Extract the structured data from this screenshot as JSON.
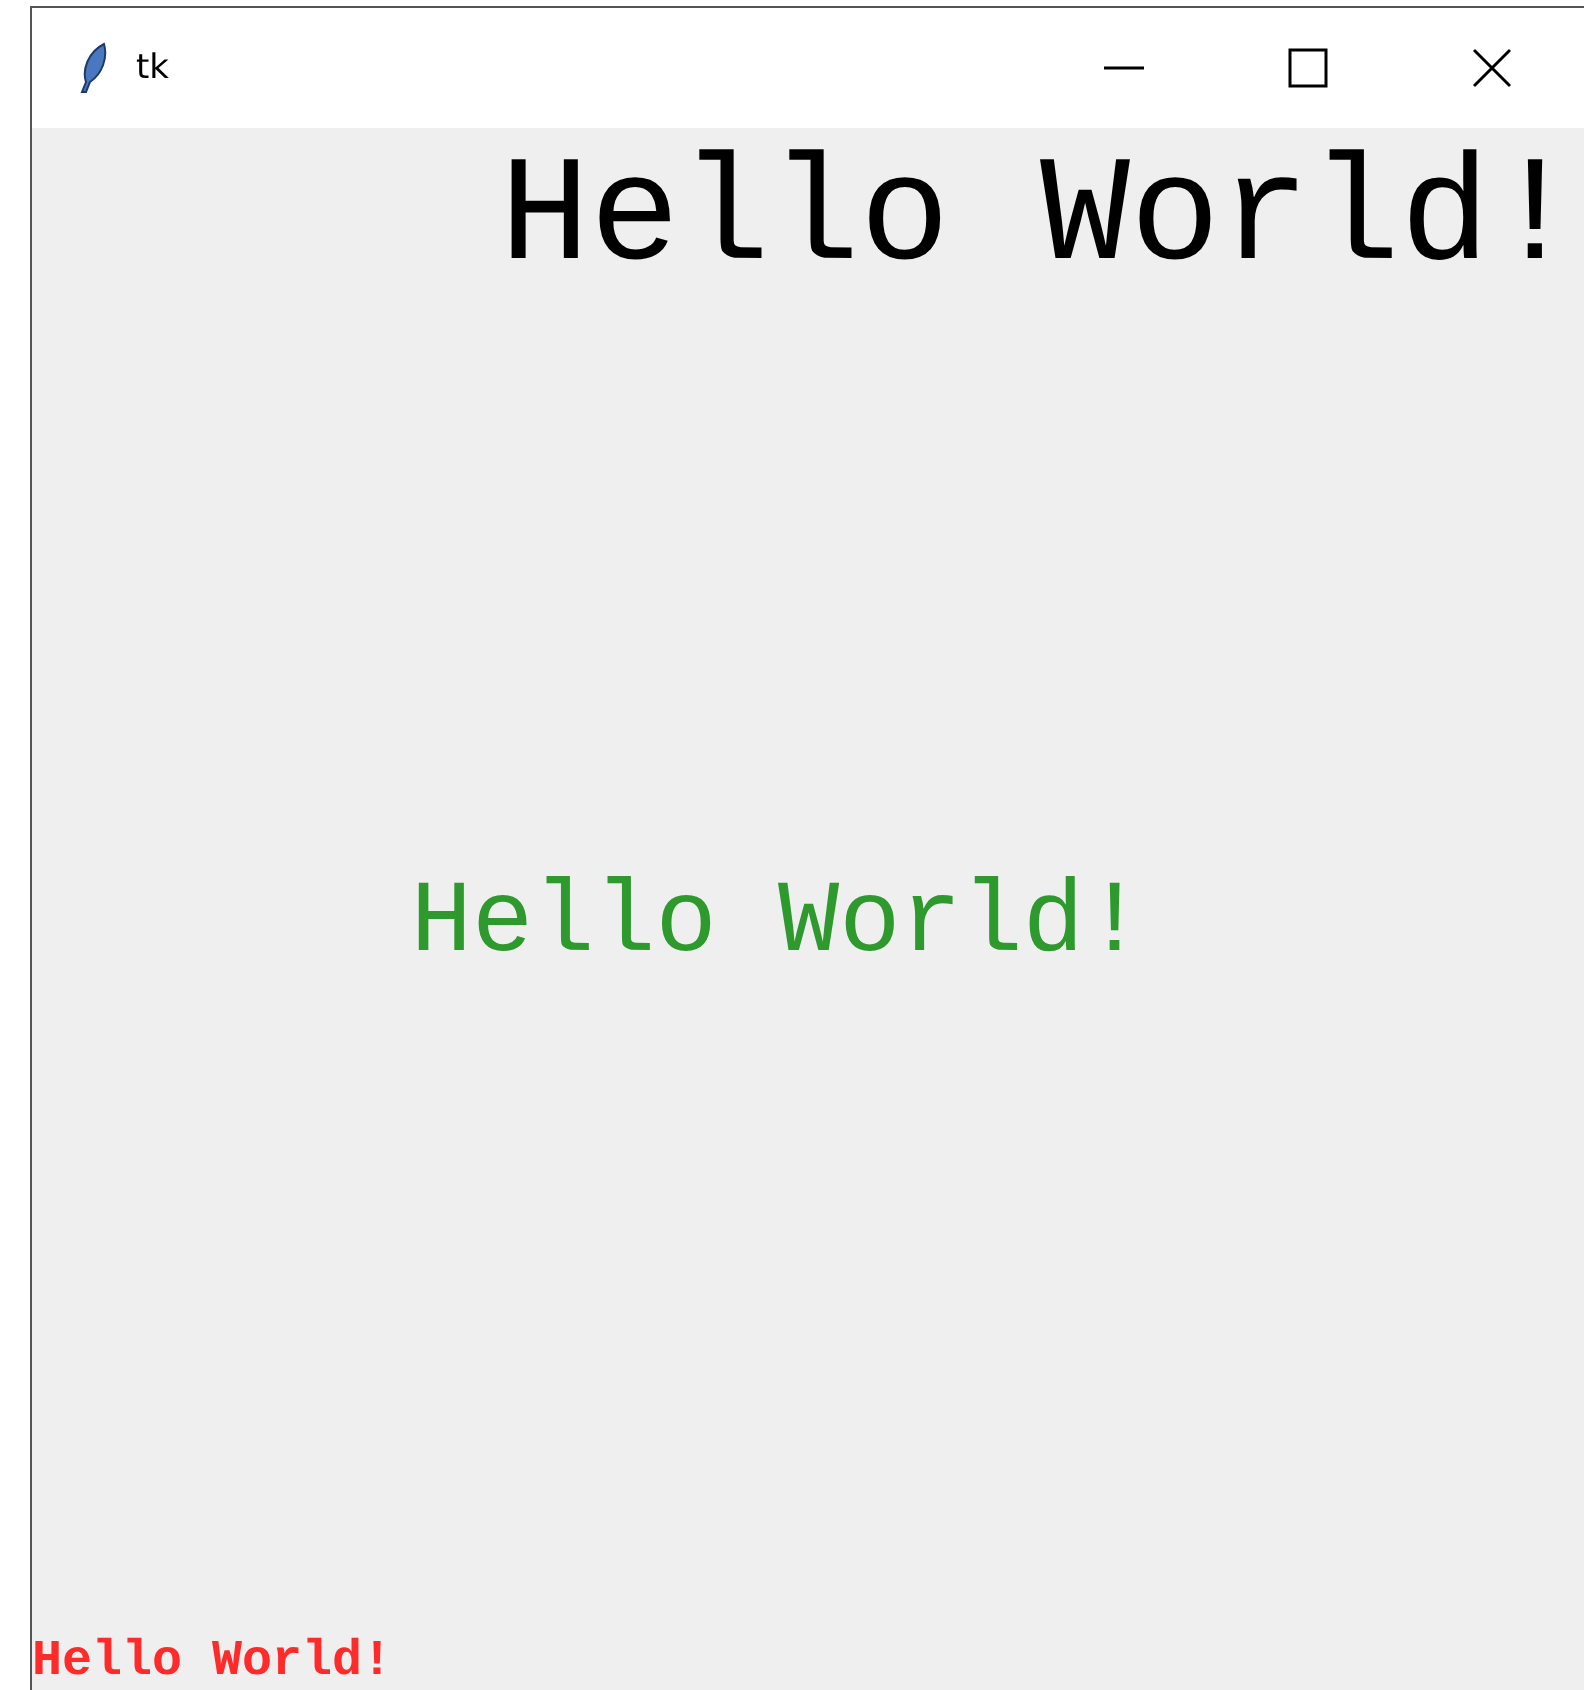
{
  "window": {
    "title": "tk"
  },
  "labels": [
    {
      "kind": "top",
      "text": "Hello World!",
      "color": "#000000"
    },
    {
      "kind": "center",
      "text": "Hello World!",
      "color": "#2e9a2e"
    },
    {
      "kind": "bottom",
      "text": "Hello World!",
      "color": "#ff2a2a"
    }
  ]
}
